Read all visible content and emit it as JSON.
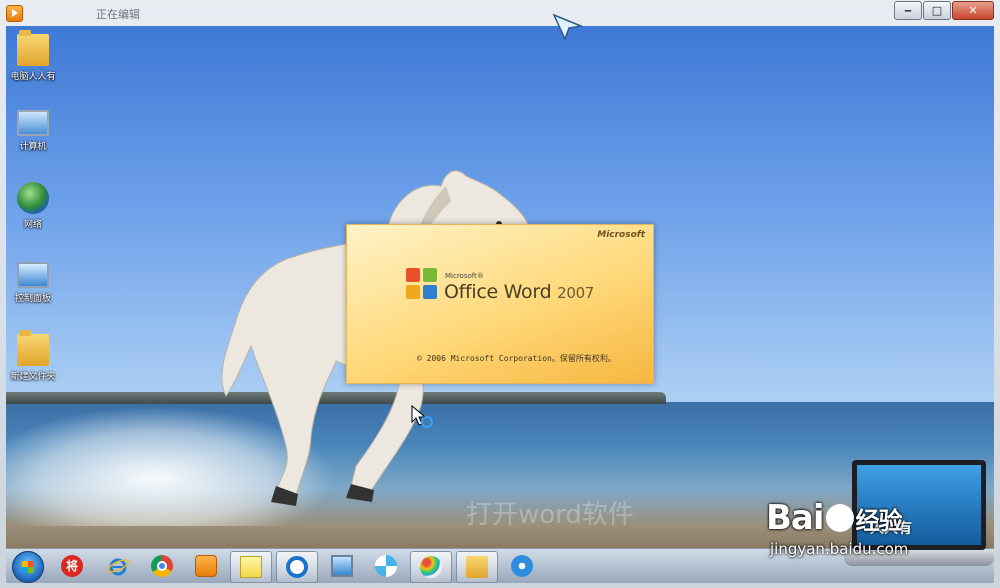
{
  "window": {
    "title": "正在编辑",
    "controls": {
      "minimize": "‒",
      "maximize": "□",
      "close": "✕"
    }
  },
  "desktop_icons": [
    {
      "label": "电脑人人有",
      "icon": "folder-user-icon"
    },
    {
      "label": "计算机",
      "icon": "computer-icon"
    },
    {
      "label": "网络",
      "icon": "network-icon"
    },
    {
      "label": "控制面板",
      "icon": "control-panel-icon"
    },
    {
      "label": "新建文件夹",
      "icon": "folder-icon"
    }
  ],
  "splash": {
    "brand": "Microsoft",
    "product_prefix": "Microsoft®",
    "product": "Office Word",
    "year": "2007",
    "copyright": "© 2006 Microsoft Corporation。保留所有权利。"
  },
  "overlay_text": "打开word软件",
  "taskbar": {
    "items": [
      {
        "name": "start",
        "icon": "windows-start-icon"
      },
      {
        "name": "jiang",
        "icon": "jiang-app-icon",
        "glyph": "将"
      },
      {
        "name": "ie",
        "icon": "internet-explorer-icon"
      },
      {
        "name": "chrome",
        "icon": "chrome-icon"
      },
      {
        "name": "media",
        "icon": "media-player-icon"
      },
      {
        "name": "notes",
        "icon": "sticky-notes-icon"
      },
      {
        "name": "browser",
        "icon": "browser-circle-icon"
      },
      {
        "name": "remote",
        "icon": "remote-desktop-icon"
      },
      {
        "name": "pinwheel",
        "icon": "pinwheel-icon"
      },
      {
        "name": "paint",
        "icon": "paint-icon"
      },
      {
        "name": "explorer",
        "icon": "file-explorer-icon"
      },
      {
        "name": "assistant",
        "icon": "assistant-icon"
      }
    ]
  },
  "watermark": {
    "baidu": "Bai",
    "baidu_suffix": "经验",
    "url": "jingyan.baidu.com",
    "laptop_caption": "人人有"
  },
  "colors": {
    "splash_gradient_end": "#f6b640",
    "sky": "#3f79d6",
    "taskbar": "#b4c1d2"
  }
}
